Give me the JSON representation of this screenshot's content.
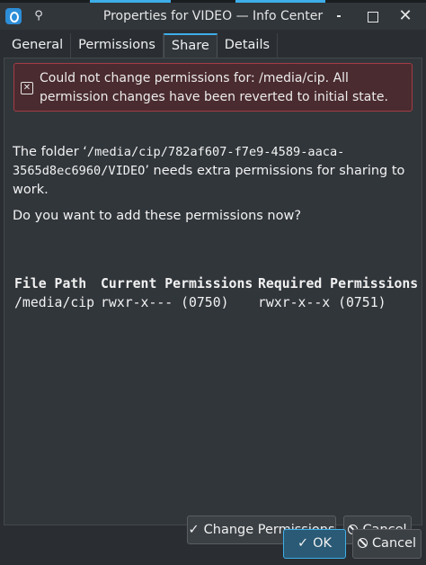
{
  "window": {
    "title": "Properties for VIDEO — Info Center",
    "icons": {
      "app": "info-center-icon",
      "pin": "pin-icon",
      "minimize": "minimize-icon",
      "maximize": "maximize-icon",
      "close": "close-icon"
    },
    "close_glyph": "✕",
    "pin_glyph": "📌"
  },
  "tabs": [
    {
      "label": "General"
    },
    {
      "label": "Permissions"
    },
    {
      "label": "Share"
    },
    {
      "label": "Details"
    }
  ],
  "active_tab": "Share",
  "error": {
    "icon": "error-icon",
    "glyph": "✕",
    "text": "Could not change permissions for: /media/cip. All permission changes have been reverted to initial state."
  },
  "message": {
    "prefix": "The folder ‘",
    "path": "/media/cip/782af607-f7e9-4589-aaca-3565d8ec6960/VIDEO",
    "suffix": "’ needs extra permissions for sharing to work.",
    "question": "Do you want to add these permissions now?"
  },
  "permissions_table": {
    "headers": [
      "File Path",
      "Current Permissions",
      "Required Permissions"
    ],
    "rows": [
      [
        "/media/cip",
        "rwxr-x--- (0750)",
        "rwxr-x--x (0751)"
      ]
    ]
  },
  "buttons": {
    "change_permissions": "Change Permissions",
    "cancel_inner": "Cancel",
    "ok": "OK",
    "cancel": "Cancel",
    "check_glyph": "✓"
  },
  "colors": {
    "accent": "#3daee9",
    "error_bg": "#4a2b2f",
    "error_border": "#a43c46",
    "window_bg": "#2a2e32"
  }
}
